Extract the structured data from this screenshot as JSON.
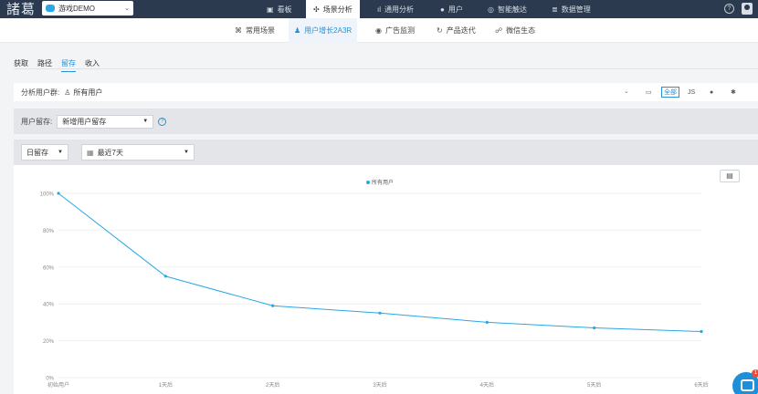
{
  "topnav": {
    "logo": "諸葛",
    "app_select": "游戏DEMO",
    "items": [
      {
        "label": "看板",
        "icon": "dashboard-icon"
      },
      {
        "label": "场景分析",
        "icon": "scene-icon",
        "active": true
      },
      {
        "label": "通用分析",
        "icon": "bar-chart-icon"
      },
      {
        "label": "用户",
        "icon": "user-icon"
      },
      {
        "label": "智能触达",
        "icon": "target-icon"
      },
      {
        "label": "数据管理",
        "icon": "data-icon"
      }
    ],
    "help": "?"
  },
  "subnav": {
    "items": [
      {
        "label": "常用场景",
        "icon": "grid-icon"
      },
      {
        "label": "用户增长2A3R",
        "icon": "user-growth-icon",
        "active": true
      },
      {
        "label": "广告监测",
        "icon": "ad-icon"
      },
      {
        "label": "产品迭代",
        "icon": "cycle-icon"
      },
      {
        "label": "微信生态",
        "icon": "wechat-icon"
      }
    ]
  },
  "tabs": [
    {
      "label": "获取"
    },
    {
      "label": "路径"
    },
    {
      "label": "留存",
      "active": true
    },
    {
      "label": "收入"
    }
  ],
  "filter": {
    "group_label": "分析用户群:",
    "group_value": "所有用户",
    "platforms": [
      {
        "label": "全部",
        "active": true
      }
    ]
  },
  "retention": {
    "label": "用户留存:",
    "value": "新增用户留存"
  },
  "period": {
    "type_value": "日留存",
    "range_value": "最近7天"
  },
  "colors": {
    "accent": "#2a8fd4",
    "line": "#2aa7e5",
    "nav_bg": "#2b3a4e"
  },
  "chart_data": {
    "type": "line",
    "title": "",
    "legend": [
      "所有用户"
    ],
    "legend_position": "top",
    "categories": [
      "初始用户",
      "1天后",
      "2天后",
      "3天后",
      "4天后",
      "5天后",
      "6天后"
    ],
    "series": [
      {
        "name": "所有用户",
        "values": [
          100,
          55,
          39,
          35,
          30,
          27,
          25
        ]
      }
    ],
    "ylim": [
      0,
      100
    ],
    "yticks": [
      "0%",
      "20%",
      "40%",
      "60%",
      "80%",
      "100%"
    ],
    "grid": true
  }
}
